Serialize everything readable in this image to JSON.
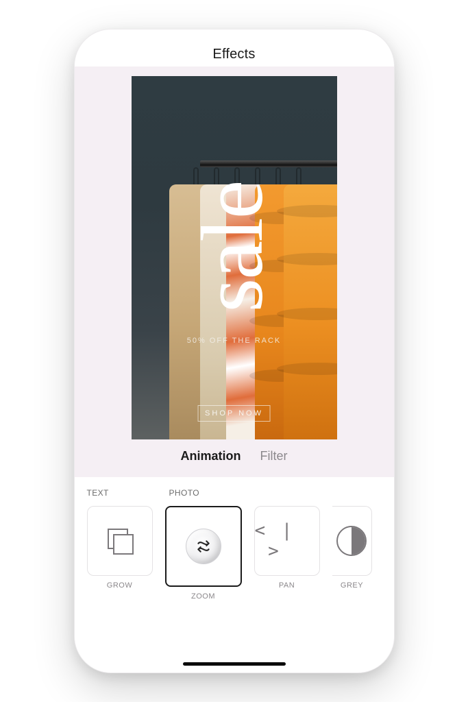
{
  "header": {
    "title": "Effects"
  },
  "artboard": {
    "headline": "sale",
    "subline": "50% OFF THE RACK",
    "cta": "SHOP NOW"
  },
  "tabs": {
    "animation": "Animation",
    "filter": "Filter",
    "active": "animation"
  },
  "sections": {
    "text": "TEXT",
    "photo": "PHOTO"
  },
  "thumbs": {
    "grow": {
      "label": "GROW",
      "selected": false
    },
    "zoom": {
      "label": "ZOOM",
      "selected": true
    },
    "pan": {
      "label": "PAN",
      "selected": false
    },
    "grey": {
      "label": "GREY",
      "selected": false
    }
  },
  "colors": {
    "canvas_bg": "#f5eff4",
    "text_primary": "#1a1a1a",
    "text_muted": "#8a878a",
    "border": "#e4e2e4",
    "selected_border": "#1a1a1a"
  }
}
